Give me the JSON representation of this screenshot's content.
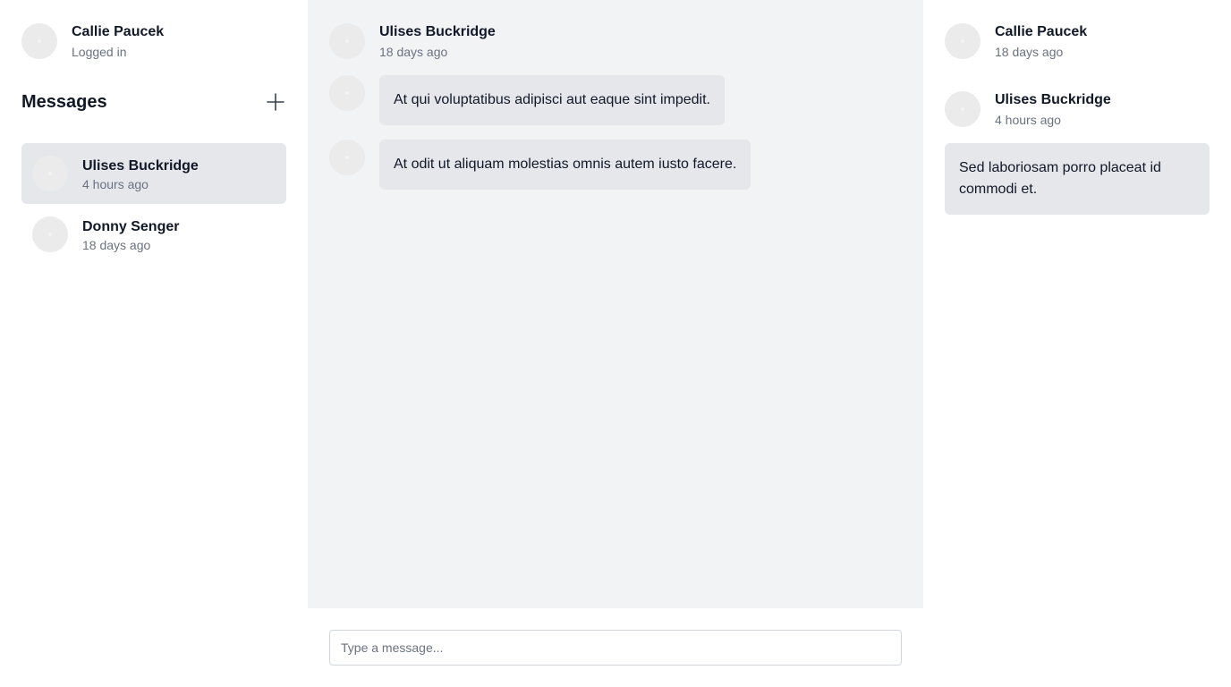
{
  "current_user": {
    "name": "Callie Paucek",
    "status": "Logged in"
  },
  "sidebar": {
    "title": "Messages",
    "add_icon": "plus-icon",
    "conversations": [
      {
        "name": "Ulises Buckridge",
        "time": "4 hours ago",
        "active": true
      },
      {
        "name": "Donny Senger",
        "time": "18 days ago",
        "active": false
      }
    ]
  },
  "chat": {
    "sender": "Ulises Buckridge",
    "time": "18 days ago",
    "messages": [
      {
        "text": "At qui voluptatibus adipisci aut eaque sint impedit."
      },
      {
        "text": "At odit ut aliquam molestias omnis autem iusto facere."
      }
    ],
    "input_placeholder": "Type a message..."
  },
  "details": {
    "participants": [
      {
        "name": "Callie Paucek",
        "time": "18 days ago"
      },
      {
        "name": "Ulises Buckridge",
        "time": "4 hours ago"
      }
    ],
    "message": "Sed laboriosam porro placeat id commodi et."
  },
  "colors": {
    "chat_bg": "#f2f3f5",
    "bubble_bg": "#e5e7eb",
    "muted_text": "#6b7280"
  }
}
